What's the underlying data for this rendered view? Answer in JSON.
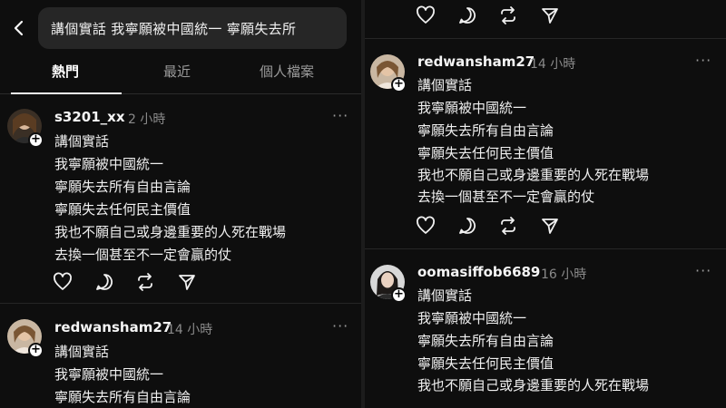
{
  "search": {
    "query": "講個實話 我寧願被中國統一 寧願失去所"
  },
  "tabs": [
    {
      "label": "熱門"
    },
    {
      "label": "最近"
    },
    {
      "label": "個人檔案"
    }
  ],
  "posts_left": [
    {
      "username": "s3201_xx",
      "time": "2 小時",
      "lines": [
        "講個實話",
        "我寧願被中國統一",
        "寧願失去所有自由言論",
        "寧願失去任何民主價值",
        "我也不願自己或身邊重要的人死在戰場",
        "去換一個甚至不一定會贏的仗"
      ]
    },
    {
      "username": "redwansham27",
      "time": "14 小時",
      "lines": [
        "講個實話",
        "我寧願被中國統一",
        "寧願失去所有自由言論"
      ]
    }
  ],
  "posts_right": [
    {
      "username": "redwansham27",
      "time": "14 小時",
      "lines": [
        "講個實話",
        "我寧願被中國統一",
        "寧願失去所有自由言論",
        "寧願失去任何民主價值",
        "我也不願自己或身邊重要的人死在戰場",
        "去換一個甚至不一定會贏的仗"
      ]
    },
    {
      "username": "oomasiffob6689",
      "time": "16 小時",
      "lines": [
        "講個實話",
        "我寧願被中國統一",
        "寧願失去所有自由言論",
        "寧願失去任何民主價值",
        "我也不願自己或身邊重要的人死在戰場"
      ]
    }
  ],
  "icons": {
    "more": "···"
  }
}
